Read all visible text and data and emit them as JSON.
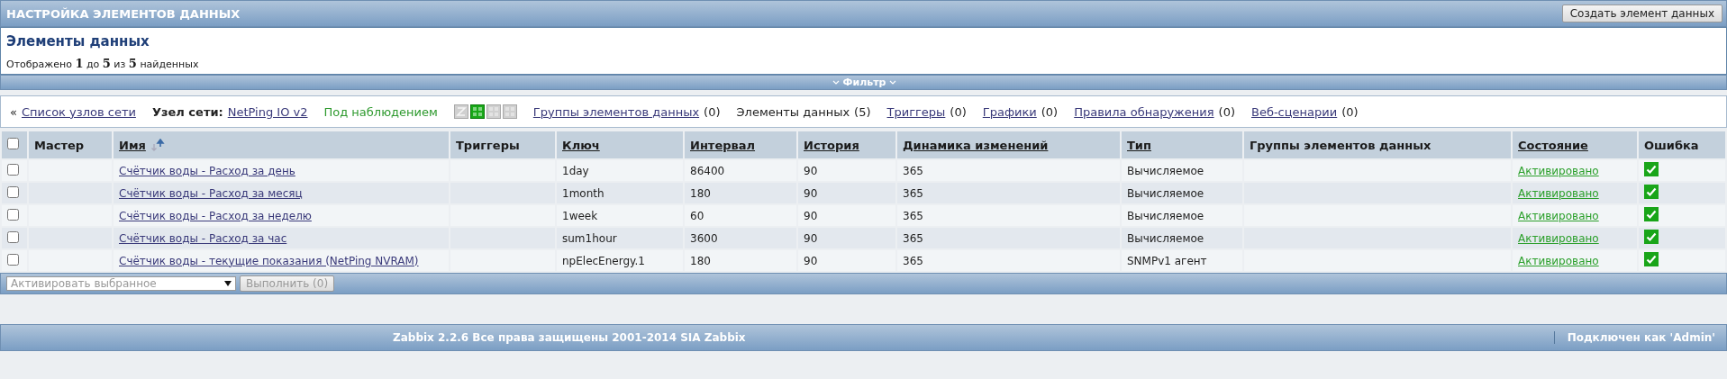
{
  "page_title": "НАСТРОЙКА ЭЛЕМЕНТОВ ДАННЫХ",
  "create_button": "Создать элемент данных",
  "header": {
    "title": "Элементы данных",
    "summary": "Отображено **1** до **5** из **5** найденных"
  },
  "filter": {
    "label": "Фильтр",
    "expanded": false
  },
  "host_nav": {
    "back_marker": "«",
    "back_link": "Список узлов сети",
    "host_label": "Узел сети:",
    "host_link": "NetPing IO v2",
    "status": "Под наблюдением",
    "interfaces": [
      {
        "kind": "zbx",
        "available": false
      },
      {
        "kind": "snmp",
        "available": true
      },
      {
        "kind": "jmx",
        "available": false
      },
      {
        "kind": "ipmi",
        "available": false
      }
    ],
    "links": [
      {
        "label": "Группы элементов данных",
        "count": "(0)",
        "selected": false
      },
      {
        "label": "Элементы данных",
        "count": "(5)",
        "selected": true
      },
      {
        "label": "Триггеры",
        "count": "(0)",
        "selected": false
      },
      {
        "label": "Графики",
        "count": "(0)",
        "selected": false
      },
      {
        "label": "Правила обнаружения",
        "count": "(0)",
        "selected": false
      },
      {
        "label": "Веб-сценарии",
        "count": "(0)",
        "selected": false
      }
    ]
  },
  "table": {
    "all_checked": false,
    "columns": [
      {
        "label": "Мастер",
        "sortable": false
      },
      {
        "label": "Имя",
        "sortable": true,
        "sorted": true
      },
      {
        "label": "Триггеры",
        "sortable": false
      },
      {
        "label": "Ключ",
        "sortable": true
      },
      {
        "label": "Интервал",
        "sortable": true
      },
      {
        "label": "История",
        "sortable": true
      },
      {
        "label": "Динамика изменений",
        "sortable": true
      },
      {
        "label": "Тип",
        "sortable": true
      },
      {
        "label": "Группы элементов данных",
        "sortable": false
      },
      {
        "label": "Состояние",
        "sortable": true
      },
      {
        "label": "Ошибка",
        "sortable": false
      }
    ],
    "rows": [
      {
        "checked": false,
        "name": "Счётчик воды - Расход за день",
        "key": "1day",
        "interval": "86400",
        "history": "90",
        "trends": "365",
        "type": "Вычисляемое",
        "status": "Активировано",
        "error": false
      },
      {
        "checked": false,
        "name": "Счётчик воды - Расход за месяц",
        "key": "1month",
        "interval": "180",
        "history": "90",
        "trends": "365",
        "type": "Вычисляемое",
        "status": "Активировано",
        "error": false
      },
      {
        "checked": false,
        "name": "Счётчик воды - Расход за неделю",
        "key": "1week",
        "interval": "60",
        "history": "90",
        "trends": "365",
        "type": "Вычисляемое",
        "status": "Активировано",
        "error": false
      },
      {
        "checked": false,
        "name": "Счётчик воды - Расход за час",
        "key": "sum1hour",
        "interval": "3600",
        "history": "90",
        "trends": "365",
        "type": "Вычисляемое",
        "status": "Активировано",
        "error": false
      },
      {
        "checked": false,
        "name": "Счётчик воды - текущие показания (NetPing NVRAM)",
        "key": "npElecEnergy.1",
        "interval": "180",
        "history": "90",
        "trends": "365",
        "type": "SNMPv1 агент",
        "status": "Активировано",
        "error": false
      }
    ]
  },
  "actions": {
    "select": "Активировать выбранное",
    "button": "Выполнить (0)",
    "button_disabled": true
  },
  "footer": {
    "copyright": "Zabbix 2.2.6 Все права защищены 2001-2014 SIA Zabbix",
    "user": "Подключен как 'Admin'"
  }
}
